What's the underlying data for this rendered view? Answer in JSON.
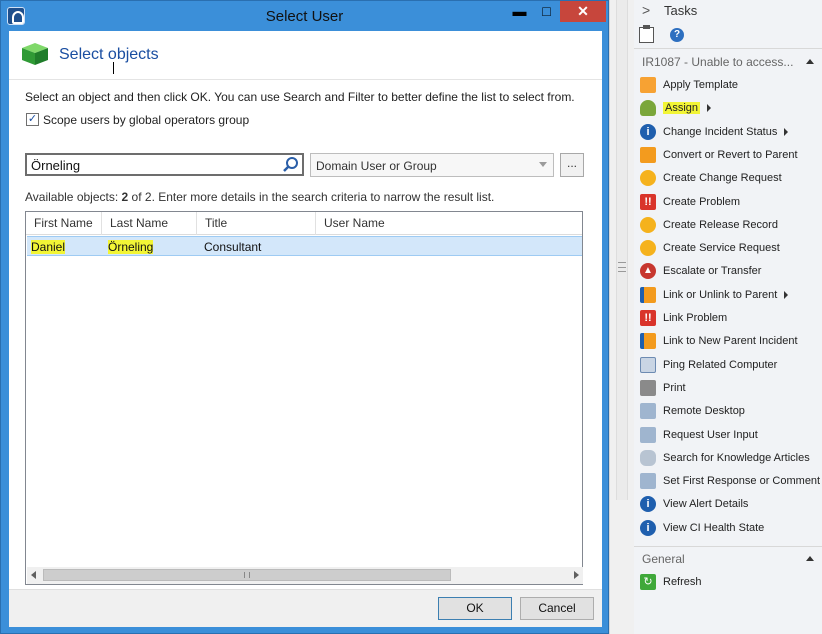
{
  "dialog": {
    "title": "Select User",
    "minimize": "▬",
    "maximize": "□",
    "close": "✕",
    "header_title": "Select objects",
    "instructions": "Select an object and then click OK. You can use Search and Filter to better define the list to select from.",
    "scope_checkbox": {
      "checked": true,
      "mark": "✓",
      "label": "Scope users by global operators group"
    },
    "search": {
      "value": "Örneling",
      "placeholder": ""
    },
    "filter_combo": {
      "selected": "Domain User or Group"
    },
    "browse_label": "...",
    "available": {
      "prefix": "Available objects:",
      "count": "2",
      "suffix": "of 2. Enter more details in the search criteria to narrow the result list."
    },
    "columns": [
      "First Name",
      "Last Name",
      "Title",
      "User Name"
    ],
    "rows": [
      {
        "first_name": "Daniel",
        "last_name": "Örneling",
        "title": "Consultant",
        "user_name": ""
      }
    ],
    "ok_label": "OK",
    "cancel_label": "Cancel"
  },
  "tasks": {
    "header": "Tasks",
    "chevron": ">",
    "help_glyph": "?",
    "section_incident": "IR1087 - Unable to access...",
    "items": [
      {
        "label": "Apply Template",
        "icon": "template-icon",
        "submenu": false
      },
      {
        "label": "Assign",
        "icon": "assign-person-icon",
        "submenu": true,
        "highlighted": true
      },
      {
        "label": "Change Incident Status",
        "icon": "info-icon",
        "submenu": true
      },
      {
        "label": "Convert or Revert to Parent",
        "icon": "convert-icon",
        "submenu": false
      },
      {
        "label": "Create Change Request",
        "icon": "sunburst-icon",
        "submenu": false
      },
      {
        "label": "Create Problem",
        "icon": "problem-icon",
        "submenu": false
      },
      {
        "label": "Create Release Record",
        "icon": "sunburst-icon",
        "submenu": false
      },
      {
        "label": "Create Service Request",
        "icon": "sunburst-icon",
        "submenu": false
      },
      {
        "label": "Escalate or Transfer",
        "icon": "escalate-icon",
        "submenu": false
      },
      {
        "label": "Link or Unlink to Parent",
        "icon": "link-parent-icon",
        "submenu": true
      },
      {
        "label": "Link Problem",
        "icon": "problem-icon",
        "submenu": false
      },
      {
        "label": "Link to New Parent Incident",
        "icon": "link-parent-icon",
        "submenu": false
      },
      {
        "label": "Ping Related Computer",
        "icon": "computer-icon",
        "submenu": false
      },
      {
        "label": "Print",
        "icon": "printer-icon",
        "submenu": false
      },
      {
        "label": "Remote Desktop",
        "icon": "remote-desktop-icon",
        "submenu": false
      },
      {
        "label": "Request User Input",
        "icon": "user-input-icon",
        "submenu": false
      },
      {
        "label": "Search for Knowledge Articles",
        "icon": "chain-link-icon",
        "submenu": false
      },
      {
        "label": "Set First Response or Comment",
        "icon": "comment-icon",
        "submenu": false
      },
      {
        "label": "View Alert Details",
        "icon": "info-icon",
        "submenu": false
      },
      {
        "label": "View CI Health State",
        "icon": "info-icon",
        "submenu": false
      }
    ],
    "section_general": "General",
    "general_items": [
      {
        "label": "Refresh",
        "icon": "refresh-icon"
      }
    ]
  },
  "colors": {
    "title_bar": "#3b8fd9",
    "close_button": "#c7463c",
    "highlight": "#f2f536",
    "selection": "#d3e7fa"
  }
}
